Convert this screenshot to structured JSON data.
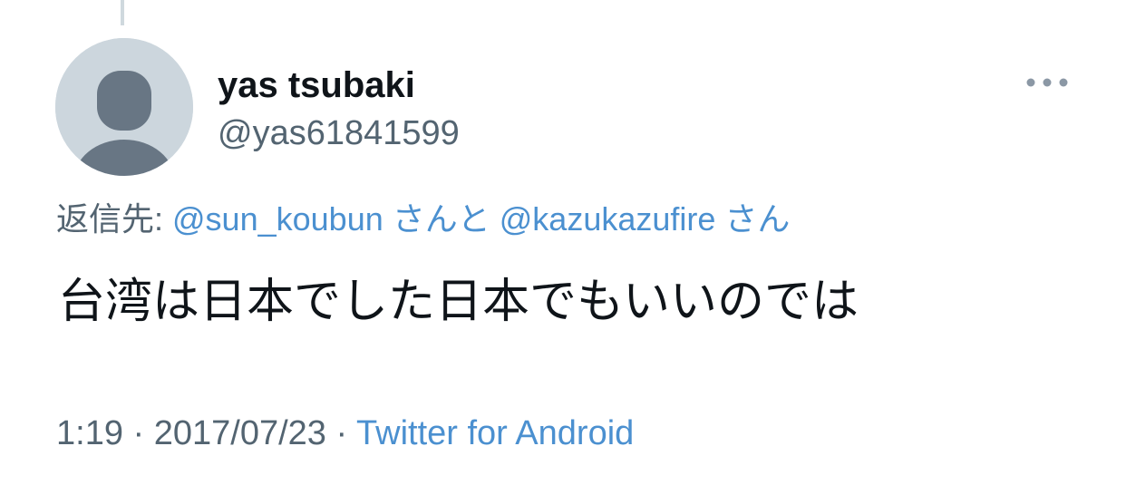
{
  "user": {
    "display_name": "yas tsubaki",
    "handle": "@yas61841599"
  },
  "reply": {
    "prefix": "返信先: ",
    "mention_1": "@sun_koubun",
    "joiner": " さんと ",
    "mention_2": "@kazukazufire",
    "suffix": " さん"
  },
  "tweet": {
    "text": "台湾は日本でした日本でもいいのでは"
  },
  "meta": {
    "time": "1:19",
    "separator_1": " · ",
    "date": "2017/07/23",
    "separator_2": " · ",
    "source": "Twitter for Android"
  },
  "icons": {
    "avatar": "default-profile-icon",
    "more": "more-options-icon"
  },
  "colors": {
    "link": "#4b90d0",
    "text_primary": "#0f1419",
    "text_secondary": "#536471",
    "avatar_bg": "#ccd6dd",
    "avatar_figure": "#687684"
  }
}
